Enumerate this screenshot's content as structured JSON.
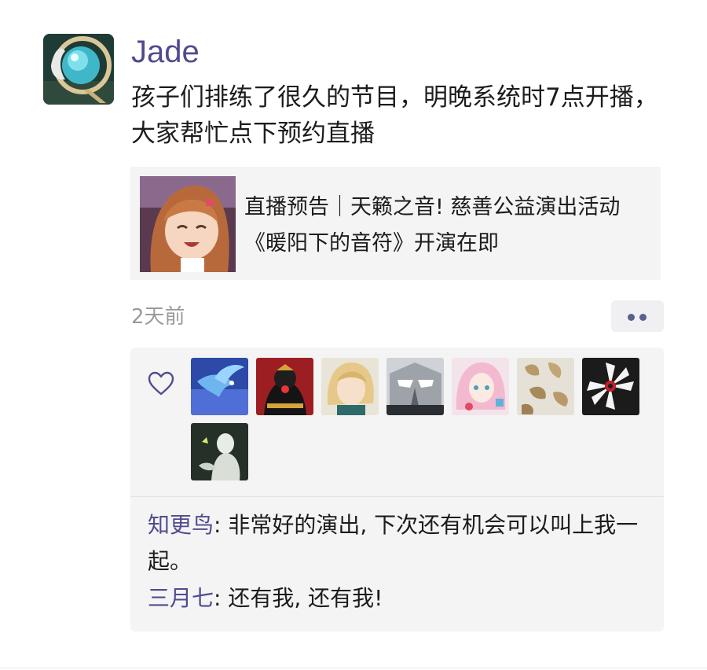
{
  "post": {
    "author": "Jade",
    "text": "孩子们排练了很久的节目，明晚系统时7点开播，大家帮忙点下预约直播",
    "shared_card": {
      "title": "直播预告｜天籁之音! 慈善公益演出活动《暖阳下的音符》开演在即"
    },
    "time": "2天前",
    "more_icon": "more-dots-icon"
  },
  "likes": {
    "icon": "heart-outline-icon",
    "users": [
      "bird-avatar",
      "black-dress-avatar",
      "blonde-avatar",
      "mask-avatar",
      "pink-hair-avatar",
      "gold-leaves-avatar",
      "white-flower-avatar",
      "white-figure-avatar"
    ]
  },
  "comments": [
    {
      "name": "知更鸟",
      "separator": ": ",
      "text": "非常好的演出, 下次还有机会可以叫上我一起。"
    },
    {
      "name": "三月七",
      "separator": ": ",
      "text": "还有我, 还有我!"
    }
  ],
  "colors": {
    "accent": "#4f4b8f",
    "card_bg": "#f4f4f4",
    "muted": "#9b9b9b"
  }
}
